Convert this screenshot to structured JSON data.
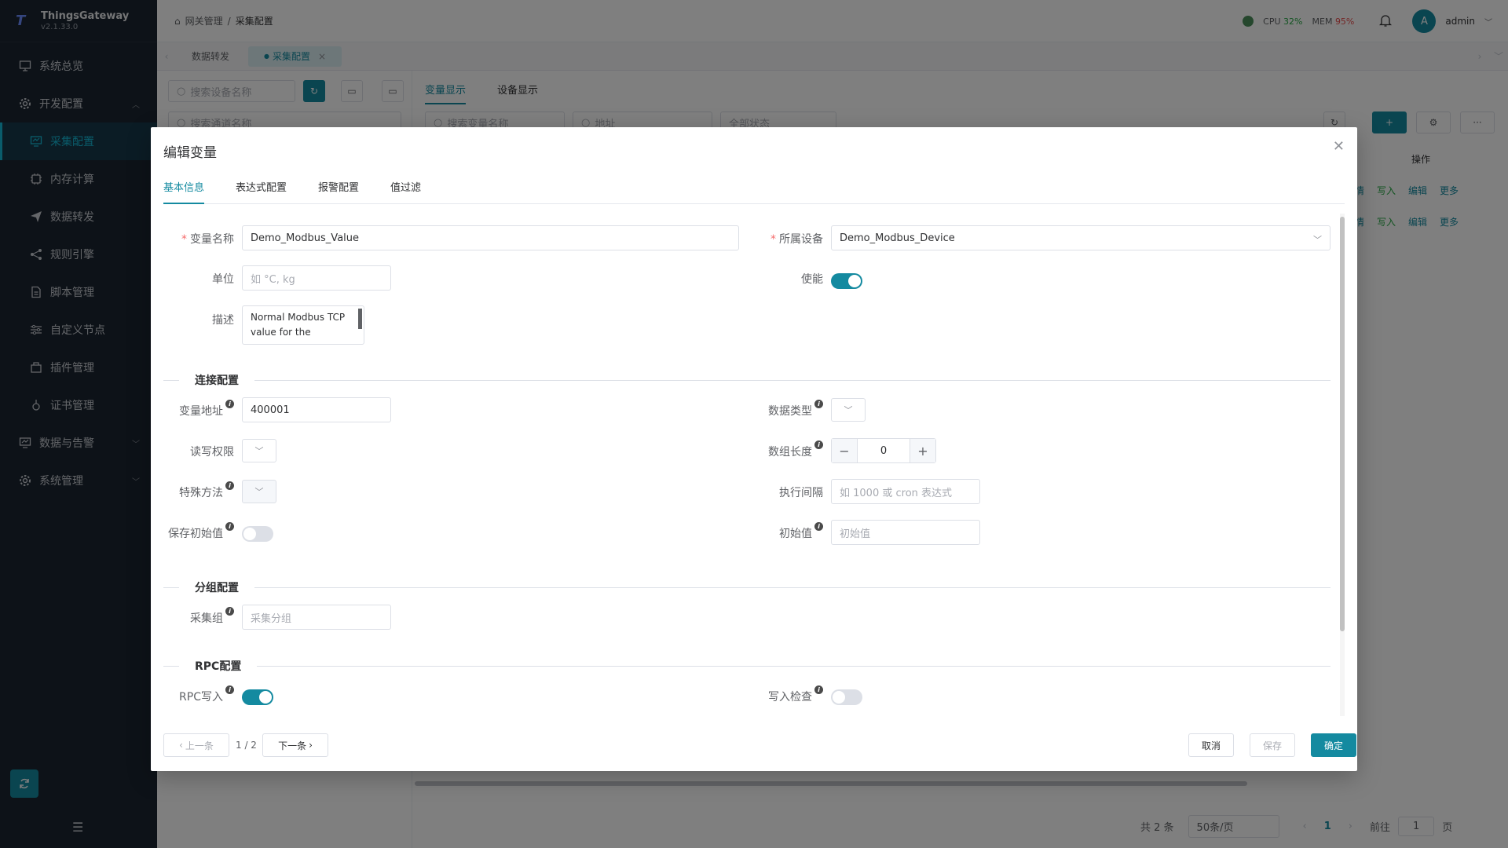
{
  "app": {
    "name": "ThingsGateway",
    "version": "v2.1.33.0"
  },
  "sidebar": {
    "items": [
      {
        "label": "系统总览",
        "icon": "monitor-icon",
        "level": "top"
      },
      {
        "label": "开发配置",
        "icon": "gear-icon",
        "level": "top",
        "expanded": true
      },
      {
        "label": "采集配置",
        "icon": "collect-icon",
        "level": "sub",
        "active": true
      },
      {
        "label": "内存计算",
        "icon": "chip-icon",
        "level": "sub"
      },
      {
        "label": "数据转发",
        "icon": "send-icon",
        "level": "sub"
      },
      {
        "label": "规则引擎",
        "icon": "share-icon",
        "level": "sub"
      },
      {
        "label": "脚本管理",
        "icon": "file-icon",
        "level": "sub"
      },
      {
        "label": "自定义节点",
        "icon": "sliders-icon",
        "level": "sub"
      },
      {
        "label": "插件管理",
        "icon": "plugin-icon",
        "level": "sub"
      },
      {
        "label": "证书管理",
        "icon": "cert-icon",
        "level": "sub"
      },
      {
        "label": "数据与告警",
        "icon": "chart-icon",
        "level": "top"
      },
      {
        "label": "系统管理",
        "icon": "settings-icon",
        "level": "top"
      }
    ]
  },
  "header": {
    "breadcrumb": [
      "网关管理",
      "采集配置"
    ],
    "cpu_label": "CPU",
    "cpu_value": "32%",
    "mem_label": "MEM",
    "mem_value": "95%",
    "avatar_letter": "A",
    "user": "admin"
  },
  "tabs": [
    {
      "label": "数据转发",
      "active": false
    },
    {
      "label": "采集配置",
      "active": true
    }
  ],
  "background": {
    "device_search_placeholder": "搜索设备名称",
    "channel_search_placeholder": "搜索通道名称",
    "view_tabs": [
      "变量显示",
      "设备显示"
    ],
    "var_search_placeholder": "搜索变量名称",
    "address_placeholder": "地址",
    "status_placeholder": "全部状态",
    "col_ops": "操作",
    "row_actions": {
      "detail": "情",
      "write": "写入",
      "edit": "编辑",
      "more": "更多"
    },
    "pager": {
      "total": "共 2 条",
      "page_size": "50条/页",
      "current": "1",
      "goto_label": "前往",
      "goto_value": "1",
      "page_unit": "页"
    }
  },
  "dialog": {
    "title": "编辑变量",
    "tabs": [
      "基本信息",
      "表达式配置",
      "报警配置",
      "值过滤"
    ],
    "basic": {
      "name_label": "变量名称",
      "name_value": "Demo_Modbus_Value",
      "device_label": "所属设备",
      "device_value": "Demo_Modbus_Device",
      "unit_label": "单位",
      "unit_placeholder": "如 °C, kg",
      "enable_label": "使能",
      "enable_on": true,
      "desc_label": "描述",
      "desc_value": "Normal Modbus TCP value for the"
    },
    "connection": {
      "section": "连接配置",
      "address_label": "变量地址",
      "address_value": "400001",
      "datatype_label": "数据类型",
      "rw_label": "读写权限",
      "array_label": "数组长度",
      "array_value": "0",
      "special_label": "特殊方法",
      "interval_label": "执行间隔",
      "interval_placeholder": "如 1000 或 cron 表达式",
      "save_init_label": "保存初始值",
      "save_init_on": false,
      "init_label": "初始值",
      "init_placeholder": "初始值"
    },
    "group": {
      "section": "分组配置",
      "group_label": "采集组",
      "group_placeholder": "采集分组"
    },
    "rpc": {
      "section": "RPC配置",
      "write_label": "RPC写入",
      "write_on": true,
      "check_label": "写入检查",
      "check_on": false
    },
    "footer": {
      "prev": "上一条",
      "page": "1 / 2",
      "next": "下一条",
      "cancel": "取消",
      "save": "保存",
      "ok": "确定"
    }
  },
  "colors": {
    "accent": "#148aa0",
    "sidebar_bg": "#1b2430",
    "required": "#f56c6c"
  }
}
